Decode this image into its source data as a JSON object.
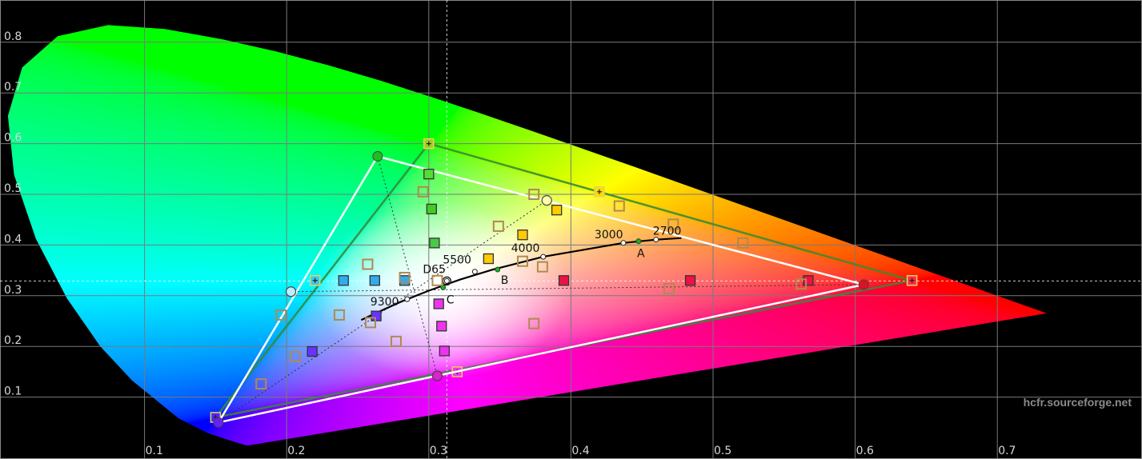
{
  "chart_data": {
    "type": "scatter",
    "subtype": "CIE 1931 xy chromaticity diagram",
    "xlim": [
      0.0,
      0.7
    ],
    "ylim": [
      0.0,
      0.9
    ],
    "x_ticks": [
      0.1,
      0.2,
      0.3,
      0.4,
      0.5,
      0.6,
      0.7
    ],
    "y_ticks": [
      0.1,
      0.2,
      0.3,
      0.4,
      0.5,
      0.6,
      0.7,
      0.8
    ],
    "x_tick_labels": [
      "0.1",
      "0.2",
      "0.3",
      "0.4",
      "0.5",
      "0.6",
      "0.7"
    ],
    "y_tick_labels": [
      "0.1",
      "0.2",
      "0.3",
      "0.4",
      "0.5",
      "0.6",
      "0.7",
      "0.8"
    ],
    "grid": true,
    "spectral_locus": [
      [
        0.1741,
        0.005
      ],
      [
        0.1738,
        0.0049
      ],
      [
        0.1721,
        0.0048
      ],
      [
        0.1689,
        0.0069
      ],
      [
        0.1644,
        0.0109
      ],
      [
        0.1566,
        0.0177
      ],
      [
        0.144,
        0.0297
      ],
      [
        0.1241,
        0.0578
      ],
      [
        0.0913,
        0.1327
      ],
      [
        0.0687,
        0.2007
      ],
      [
        0.0454,
        0.295
      ],
      [
        0.0235,
        0.4127
      ],
      [
        0.0082,
        0.5384
      ],
      [
        0.0039,
        0.6548
      ],
      [
        0.0139,
        0.7502
      ],
      [
        0.0389,
        0.812
      ],
      [
        0.0743,
        0.8338
      ],
      [
        0.1142,
        0.8262
      ],
      [
        0.1547,
        0.8059
      ],
      [
        0.1929,
        0.7816
      ],
      [
        0.2296,
        0.7543
      ],
      [
        0.2658,
        0.7243
      ],
      [
        0.3016,
        0.6923
      ],
      [
        0.3373,
        0.6589
      ],
      [
        0.3731,
        0.6245
      ],
      [
        0.4087,
        0.5896
      ],
      [
        0.4441,
        0.5547
      ],
      [
        0.4788,
        0.5202
      ],
      [
        0.5125,
        0.4866
      ],
      [
        0.5448,
        0.4544
      ],
      [
        0.5752,
        0.4242
      ],
      [
        0.6029,
        0.3965
      ],
      [
        0.627,
        0.3725
      ],
      [
        0.6482,
        0.3514
      ],
      [
        0.6658,
        0.334
      ],
      [
        0.6801,
        0.3197
      ],
      [
        0.6915,
        0.3083
      ],
      [
        0.7006,
        0.2993
      ],
      [
        0.7079,
        0.292
      ],
      [
        0.714,
        0.2859
      ],
      [
        0.719,
        0.2809
      ],
      [
        0.723,
        0.277
      ],
      [
        0.726,
        0.274
      ],
      [
        0.7347,
        0.2653
      ]
    ],
    "reference_gamut": {
      "red": [
        0.64,
        0.33
      ],
      "green": [
        0.3,
        0.6
      ],
      "blue": [
        0.15,
        0.06
      ],
      "secondaries": [
        [
          0.22,
          0.33
        ],
        [
          0.32,
          0.15
        ],
        [
          0.42,
          0.505
        ]
      ]
    },
    "measured_gamut": {
      "red": [
        0.606,
        0.322
      ],
      "green": [
        0.264,
        0.575
      ],
      "blue": [
        0.152,
        0.05
      ],
      "secondaries": [
        [
          0.203,
          0.308
        ],
        [
          0.306,
          0.142
        ],
        [
          0.383,
          0.488
        ]
      ]
    },
    "saturation_targets": [
      {
        "x": 0.3,
        "y": 0.54,
        "color": "#55dd33"
      },
      {
        "x": 0.302,
        "y": 0.471,
        "color": "#44cc22"
      },
      {
        "x": 0.304,
        "y": 0.404,
        "color": "#44cc44"
      },
      {
        "x": 0.39,
        "y": 0.469,
        "color": "#ffcc00"
      },
      {
        "x": 0.366,
        "y": 0.42,
        "color": "#ffcc00"
      },
      {
        "x": 0.342,
        "y": 0.373,
        "color": "#ffcc00"
      },
      {
        "x": 0.24,
        "y": 0.33,
        "color": "#33aaee"
      },
      {
        "x": 0.262,
        "y": 0.33,
        "color": "#33aaee"
      },
      {
        "x": 0.283,
        "y": 0.33,
        "color": "#33aaee"
      },
      {
        "x": 0.395,
        "y": 0.33,
        "color": "#ee1144"
      },
      {
        "x": 0.484,
        "y": 0.33,
        "color": "#ee1144"
      },
      {
        "x": 0.567,
        "y": 0.33,
        "color": "#ee1144"
      },
      {
        "x": 0.311,
        "y": 0.191,
        "color": "#ee33ee"
      },
      {
        "x": 0.309,
        "y": 0.24,
        "color": "#ee33ee"
      },
      {
        "x": 0.307,
        "y": 0.284,
        "color": "#ee33ee"
      },
      {
        "x": 0.218,
        "y": 0.19,
        "color": "#6633ff"
      },
      {
        "x": 0.263,
        "y": 0.26,
        "color": "#6633ff"
      }
    ],
    "measured_points": [
      [
        0.296,
        0.505
      ],
      [
        0.374,
        0.5
      ],
      [
        0.434,
        0.477
      ],
      [
        0.472,
        0.441
      ],
      [
        0.521,
        0.404
      ],
      [
        0.349,
        0.437
      ],
      [
        0.38,
        0.357
      ],
      [
        0.366,
        0.368
      ],
      [
        0.374,
        0.245
      ],
      [
        0.469,
        0.314
      ],
      [
        0.562,
        0.323
      ],
      [
        0.206,
        0.18
      ],
      [
        0.196,
        0.262
      ],
      [
        0.237,
        0.262
      ],
      [
        0.259,
        0.247
      ],
      [
        0.277,
        0.21
      ],
      [
        0.257,
        0.362
      ],
      [
        0.283,
        0.336
      ],
      [
        0.306,
        0.33
      ],
      [
        0.182,
        0.126
      ]
    ],
    "blackbody_locus": [
      [
        0.2525,
        0.2522
      ],
      [
        0.2638,
        0.267
      ],
      [
        0.2806,
        0.2883
      ],
      [
        0.3,
        0.31
      ],
      [
        0.3221,
        0.3318
      ],
      [
        0.3451,
        0.3516
      ],
      [
        0.3805,
        0.3768
      ],
      [
        0.4087,
        0.3906
      ],
      [
        0.4369,
        0.4041
      ],
      [
        0.4599,
        0.4106
      ],
      [
        0.4777,
        0.4137
      ]
    ],
    "cct_labels": [
      {
        "label": "9300",
        "x": 0.2848,
        "y": 0.2932
      },
      {
        "label": "D65",
        "x": 0.3127,
        "y": 0.329
      },
      {
        "label": "5500",
        "x": 0.3324,
        "y": 0.3474
      },
      {
        "label": "4000",
        "x": 0.3805,
        "y": 0.3768
      },
      {
        "label": "3000",
        "x": 0.4369,
        "y": 0.4041
      },
      {
        "label": "2700",
        "x": 0.4599,
        "y": 0.4106
      }
    ],
    "illuminants": [
      {
        "label": "A",
        "x": 0.4476,
        "y": 0.4074
      },
      {
        "label": "B",
        "x": 0.3484,
        "y": 0.3516
      },
      {
        "label": "C",
        "x": 0.3101,
        "y": 0.3162
      }
    ],
    "crosshair": {
      "x": 0.3127,
      "y": 0.329
    },
    "colors": {
      "reference_gamut": "#3a8a3a",
      "measured_gamut": "#ffffff",
      "grid": "#7a7a7a",
      "blackbody": "#000000"
    }
  },
  "watermark": "hcfr.sourceforge.net"
}
